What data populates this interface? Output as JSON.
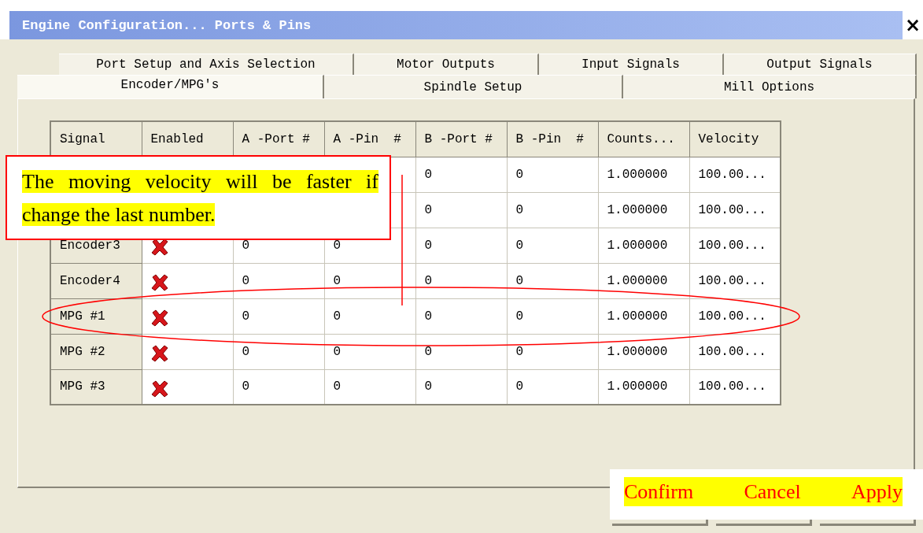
{
  "window": {
    "title": "Engine Configuration... Ports & Pins",
    "close": "×"
  },
  "tabs": {
    "back_row": [
      {
        "label": "Port Setup and Axis Selection",
        "selected": false
      },
      {
        "label": "Motor Outputs",
        "selected": false
      },
      {
        "label": "Input Signals",
        "selected": false
      },
      {
        "label": "Output Signals",
        "selected": false
      }
    ],
    "front_row": [
      {
        "label": "Encoder/MPG's",
        "selected": true
      },
      {
        "label": "Spindle Setup",
        "selected": false
      },
      {
        "label": "Mill Options",
        "selected": false
      }
    ]
  },
  "table": {
    "columns": [
      "Signal",
      "Enabled",
      "A -Port #",
      "A -Pin  #",
      "B -Port #",
      "B -Pin  #",
      "Counts...",
      "Velocity"
    ],
    "rows": [
      {
        "b_port": "0",
        "b_pin": "0",
        "counts": "1.000000",
        "velocity": "100.00..."
      },
      {
        "b_port": "0",
        "b_pin": "0",
        "counts": "1.000000",
        "velocity": "100.00..."
      },
      {
        "signal": "Encoder3",
        "enabled": false,
        "a_port": "0",
        "a_pin": "0",
        "b_port": "0",
        "b_pin": "0",
        "counts": "1.000000",
        "velocity": "100.00..."
      },
      {
        "signal": "Encoder4",
        "enabled": false,
        "a_port": "0",
        "a_pin": "0",
        "b_port": "0",
        "b_pin": "0",
        "counts": "1.000000",
        "velocity": "100.00..."
      },
      {
        "signal": "MPG #1",
        "enabled": false,
        "a_port": "0",
        "a_pin": "0",
        "b_port": "0",
        "b_pin": "0",
        "counts": "1.000000",
        "velocity": "100.00..."
      },
      {
        "signal": "MPG #2",
        "enabled": false,
        "a_port": "0",
        "a_pin": "0",
        "b_port": "0",
        "b_pin": "0",
        "counts": "1.000000",
        "velocity": "100.00..."
      },
      {
        "signal": "MPG #3",
        "enabled": false,
        "a_port": "0",
        "a_pin": "0",
        "b_port": "0",
        "b_pin": "0",
        "counts": "1.000000",
        "velocity": "100.00..."
      }
    ]
  },
  "callout": {
    "text": "The moving velocity will be faster if change the last number."
  },
  "button_labels": [
    "Confirm",
    "Cancel",
    "Apply"
  ]
}
